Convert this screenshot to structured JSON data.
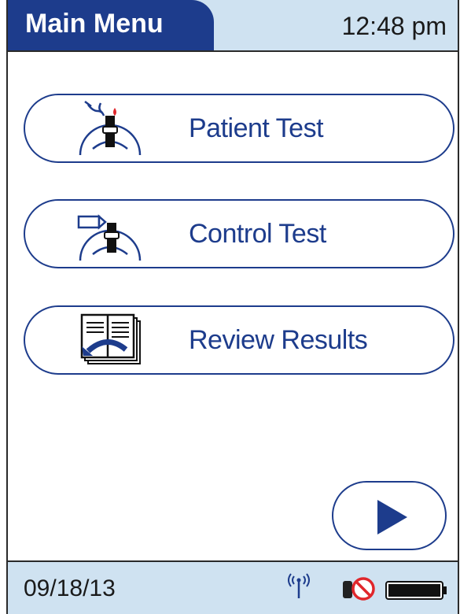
{
  "header": {
    "title": "Main Menu",
    "time": "12:48 pm"
  },
  "menu": {
    "items": [
      {
        "label": "Patient Test",
        "icon": "patient-test-icon"
      },
      {
        "label": "Control Test",
        "icon": "control-test-icon"
      },
      {
        "label": "Review Results",
        "icon": "review-results-icon"
      }
    ]
  },
  "navigation": {
    "next_icon": "play-arrow-icon"
  },
  "status_bar": {
    "date": "09/18/13",
    "icons": [
      "antenna-icon",
      "no-connection-icon",
      "battery-icon"
    ],
    "battery_level": 1.0
  },
  "colors": {
    "accent": "#1d3c8c",
    "header_bg": "#cfe2f1",
    "alert": "#e0262b"
  }
}
